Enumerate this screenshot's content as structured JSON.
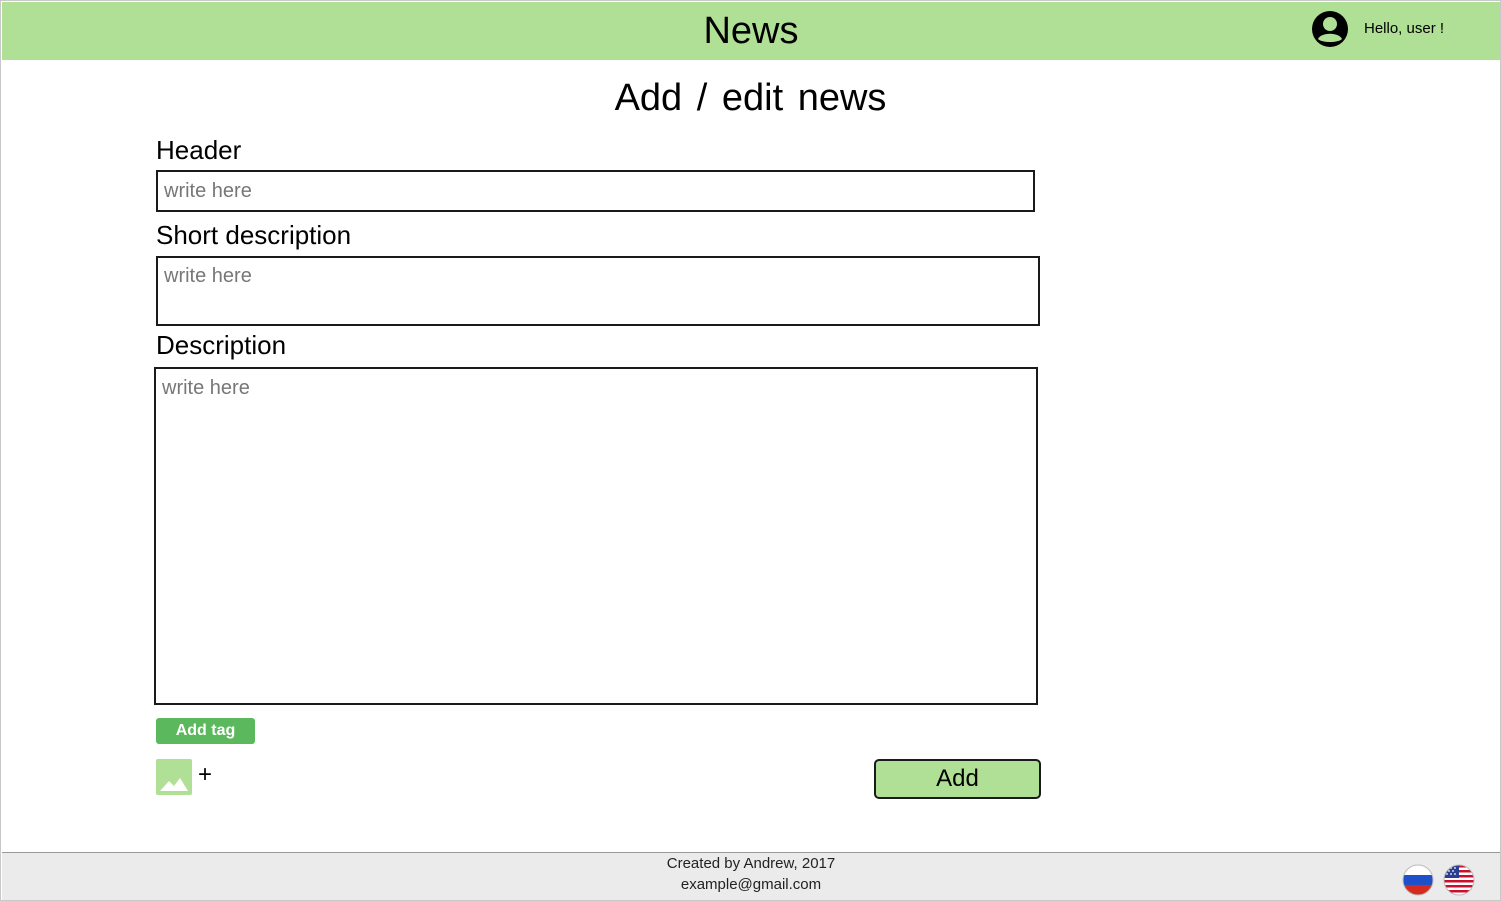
{
  "header": {
    "title": "News",
    "greeting": "Hello, user !",
    "avatar_icon": "account-circle-icon",
    "background": "#b0df96"
  },
  "page": {
    "title": "Add / edit  news"
  },
  "form": {
    "header_label": "Header",
    "header_placeholder": "write here",
    "short_description_label": "Short description",
    "short_description_placeholder": "write here",
    "description_label": "Description",
    "description_placeholder": "write here",
    "add_tag_label": "Add tag",
    "image_icon": "image-icon",
    "plus_label": "+",
    "submit_label": "Add"
  },
  "footer": {
    "credit": "Created by Andrew, 2017",
    "email": "example@gmail.com",
    "flags": [
      "russia-flag-icon",
      "usa-flag-icon"
    ]
  },
  "colors": {
    "accent": "#b0df96",
    "button_green": "#5cb85c",
    "footer_bg": "#ebebeb"
  }
}
